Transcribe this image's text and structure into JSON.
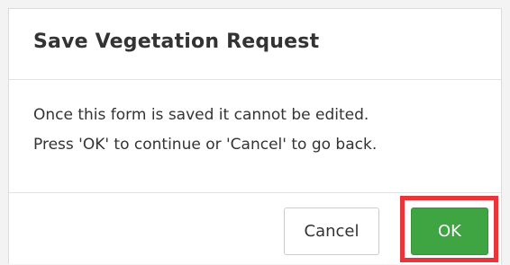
{
  "dialog": {
    "title": "Save Vegetation Request",
    "message_line1": "Once this form is saved it cannot be edited.",
    "message_line2": "Press 'OK' to continue or 'Cancel' to go back.",
    "cancel_label": "Cancel",
    "ok_label": "OK"
  },
  "colors": {
    "ok_button": "#3fa542",
    "highlight_border": "#e8353b",
    "text": "#333333"
  }
}
